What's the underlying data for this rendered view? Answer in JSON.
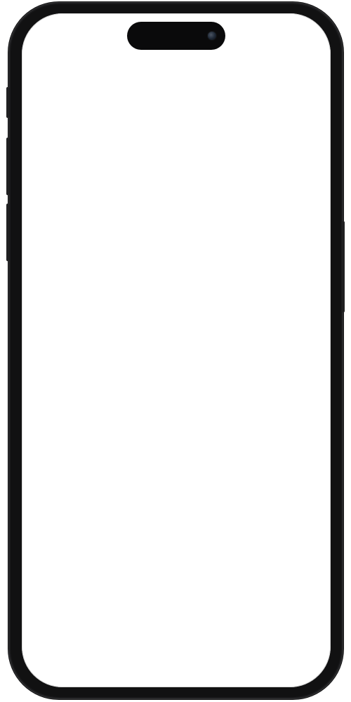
{
  "device": {
    "type": "smartphone",
    "frame_color": "#1b1b1d",
    "screen_color": "#ffffff",
    "camera_icon": "front-camera-icon"
  },
  "screen": {
    "state": "blank"
  }
}
